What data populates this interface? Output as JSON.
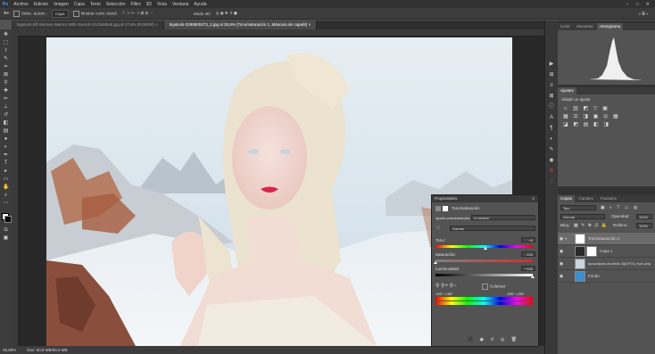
{
  "menubar": {
    "items": [
      "Archivo",
      "Edición",
      "Imagen",
      "Capa",
      "Texto",
      "Selección",
      "Filtro",
      "3D",
      "Vista",
      "Ventana",
      "Ayuda"
    ]
  },
  "optionsbar": {
    "auto_select_label": "Selec. autom.:",
    "auto_select_value": "Capa",
    "transform_controls": "Mostrar contr. transf.",
    "mode_3d": "Modo 3D:"
  },
  "tabs": [
    {
      "label": "bigstock-Elf-Woman-Warrior-With-Sword-l-212848546.jpg al 17,6% (RGB/8#)",
      "active": false
    },
    {
      "label": "bigstock-2296800473_2.jpg al 25,9% (Tono/saturación 1, Máscara de capa/8)",
      "active": true
    }
  ],
  "status": {
    "zoom": "25,89%",
    "doc": "Doc: 50,8 MB/59,3 MB"
  },
  "panels": {
    "top_tabs": [
      "Color",
      "Muestras",
      "Histograma"
    ],
    "adjust_tabs": [
      "Ajustes"
    ],
    "adjust_hint": "Añadir un ajuste",
    "layers_tabs": [
      "Capas",
      "Canales",
      "Trazados"
    ],
    "filter_label": "Tipo",
    "blend_mode": "Normal",
    "opacity_label": "Opacidad:",
    "opacity_value": "100%",
    "lock_label": "Bloq.:",
    "fill_label": "Relleno:",
    "fill_value": "100%",
    "layers": [
      {
        "name": "Tono/saturación 1",
        "selected": true
      },
      {
        "name": "Capa 1",
        "selected": false
      },
      {
        "name": "apocalipsis-ekobedi-d3p7FOt_hw4-unsplash",
        "selected": false
      },
      {
        "name": "Fondo",
        "selected": false
      }
    ]
  },
  "properties": {
    "title": "Propiedades",
    "subtitle": "Tono/saturación",
    "preset_label": "Ajuste preestablecido:",
    "preset_value": "A medida",
    "channel": "Gamas",
    "hue_label": "Tono:",
    "hue_value": "+6",
    "hue_level": 0.51,
    "sat_label": "Saturación:",
    "sat_value": "-100",
    "sat_level": 0.0,
    "light_label": "Luminosidad:",
    "light_value": "+100",
    "light_level": 1.0,
    "colorize": "Colorear",
    "range_left": "135° / 165°",
    "range_right": "195° \\ 225°"
  },
  "colors": {
    "accent": "#5b9bd5",
    "sky": "#dce8f0",
    "lips": "#d9254a"
  },
  "icons": [
    "move-icon",
    "marquee-icon",
    "lasso-icon",
    "quick-select-icon",
    "crop-icon",
    "eyedropper-icon",
    "healing-icon",
    "brush-icon",
    "stamp-icon",
    "history-brush-icon",
    "eraser-icon",
    "gradient-icon",
    "blur-icon",
    "dodge-icon",
    "pen-icon",
    "type-icon",
    "path-select-icon",
    "rectangle-icon",
    "hand-icon",
    "zoom-icon",
    "eye-icon",
    "fx-icon",
    "trash-icon"
  ]
}
